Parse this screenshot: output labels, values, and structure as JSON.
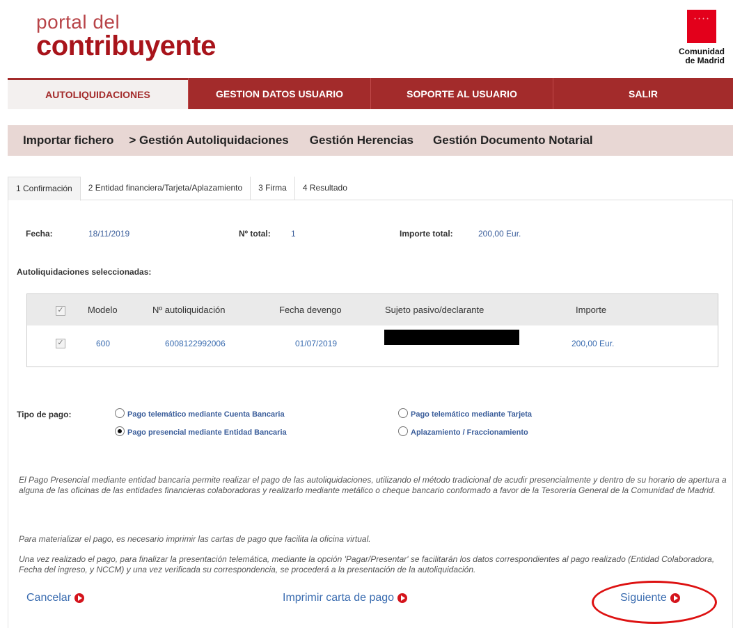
{
  "header": {
    "logo_line1": "portal del",
    "logo_line2": "contribuyente",
    "region_name_1": "Comunidad",
    "region_name_2": "de Madrid",
    "region_flag_stars": "* * * *"
  },
  "mainnav": {
    "items": [
      {
        "label": "AUTOLIQUIDACIONES",
        "active": true
      },
      {
        "label": "GESTION DATOS USUARIO"
      },
      {
        "label": "SOPORTE AL USUARIO"
      },
      {
        "label": "SALIR"
      }
    ]
  },
  "subnav": {
    "items": [
      {
        "label": "Importar fichero"
      },
      {
        "label": "> Gestión Autoliquidaciones"
      },
      {
        "label": "Gestión Herencias"
      },
      {
        "label": "Gestión Documento Notarial"
      }
    ]
  },
  "steps": {
    "tabs": [
      {
        "label": "1 Confirmación"
      },
      {
        "label": "2 Entidad financiera/Tarjeta/Aplazamiento"
      },
      {
        "label": "3 Firma"
      },
      {
        "label": "4 Resultado"
      }
    ]
  },
  "summary": {
    "fecha_label": "Fecha:",
    "fecha_value": "18/11/2019",
    "total_label": "Nº total:",
    "total_value": "1",
    "importe_label": "Importe total:",
    "importe_value": "200,00 Eur."
  },
  "selected_title": "Autoliquidaciones seleccionadas:",
  "table": {
    "headers": [
      "Modelo",
      "Nº autoliquidación",
      "Fecha devengo",
      "Sujeto pasivo/declarante",
      "Importe"
    ],
    "rows": [
      {
        "modelo": "600",
        "numero": "6008122992006",
        "fecha": "01/07/2019",
        "sujeto": "",
        "importe": "200,00 Eur."
      }
    ]
  },
  "payment": {
    "label": "Tipo de pago:",
    "options": [
      {
        "label": "Pago telemático mediante Cuenta Bancaria",
        "selected": false
      },
      {
        "label": "Pago telemático mediante Tarjeta",
        "selected": false
      },
      {
        "label": "Pago presencial mediante Entidad Bancaria",
        "selected": true
      },
      {
        "label": "Aplazamiento / Fraccionamiento",
        "selected": false
      }
    ]
  },
  "info": {
    "p1": "El Pago Presencial mediante entidad bancaria permite realizar el pago de las autoliquidaciones, utilizando el método tradicional de acudir presencialmente y dentro de su horario de apertura a alguna de las oficinas de las entidades financieras colaboradoras y realizarlo mediante metálico o cheque bancario conformado a favor de la Tesorería General de la Comunidad de Madrid.",
    "p2": "Para materializar el pago, es necesario imprimir las cartas de pago que facilita la oficina virtual.",
    "p3": "Una vez realizado el pago, para finalizar la presentación telemática, mediante la opción 'Pagar/Presentar' se facilitarán los datos correspondientes al pago realizado (Entidad Colaboradora, Fecha del ingreso, y NCCM) y una vez verificada su correspondencia, se procederá a la presentación de la autoliquidación."
  },
  "footer": {
    "cancel": "Cancelar",
    "print": "Imprimir carta de pago",
    "next": "Siguiente"
  },
  "colors": {
    "brand_red": "#a32b2b",
    "link_blue": "#3a6cb0",
    "subnav_bg": "#e8d7d4"
  }
}
